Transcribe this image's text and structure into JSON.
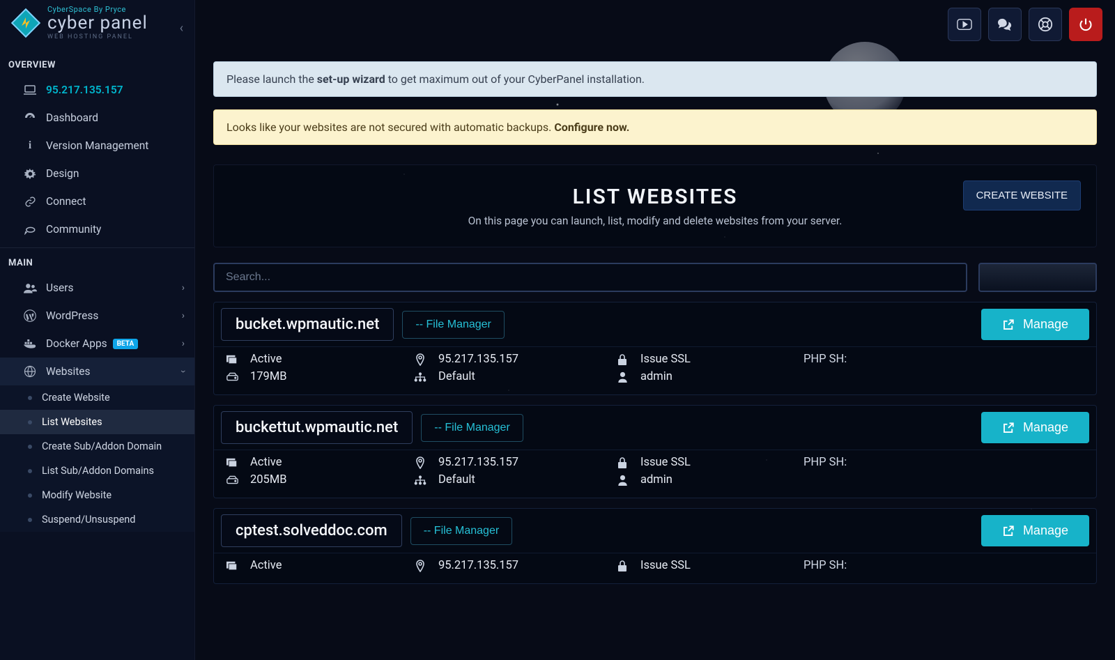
{
  "logo": {
    "tagline": "CyberSpace By Pryce",
    "main": "cyber panel",
    "sub": "WEB HOSTING PANEL"
  },
  "sidebar": {
    "sections": {
      "overview_label": "OVERVIEW",
      "main_label": "MAIN"
    },
    "ip": "95.217.135.157",
    "overview": [
      {
        "label": "Dashboard"
      },
      {
        "label": "Version Management"
      },
      {
        "label": "Design"
      },
      {
        "label": "Connect"
      },
      {
        "label": "Community"
      }
    ],
    "main": {
      "users": "Users",
      "wordpress": "WordPress",
      "docker": "Docker Apps",
      "docker_badge": "BETA",
      "websites": "Websites"
    },
    "websites_sub": [
      "Create Website",
      "List Websites",
      "Create Sub/Addon Domain",
      "List Sub/Addon Domains",
      "Modify Website",
      "Suspend/Unsuspend"
    ]
  },
  "alerts": {
    "info_pre": "Please launch the ",
    "info_bold": "set-up wizard",
    "info_post": " to get maximum out of your CyberPanel installation.",
    "warn_pre": "Looks like your websites are not secured with automatic backups. ",
    "warn_bold": "Configure now."
  },
  "hero": {
    "title": "LIST WEBSITES",
    "subtitle": "On this page you can launch, list, modify and delete websites from your server.",
    "create": "CREATE WEBSITE"
  },
  "toolbar": {
    "search_placeholder": "Search...",
    "pager_selected": ""
  },
  "common": {
    "file_manager": "-- File Manager",
    "manage": "Manage",
    "issue_ssl": "Issue SSL",
    "php_sh": "PHP SH:",
    "default": "Default"
  },
  "sites": [
    {
      "domain": "bucket.wpmautic.net",
      "status": "Active",
      "ip": "95.217.135.157",
      "size": "179MB",
      "plan": "Default",
      "owner": "admin"
    },
    {
      "domain": "buckettut.wpmautic.net",
      "status": "Active",
      "ip": "95.217.135.157",
      "size": "205MB",
      "plan": "Default",
      "owner": "admin"
    },
    {
      "domain": "cptest.solveddoc.com",
      "status": "Active",
      "ip": "95.217.135.157",
      "size": "",
      "plan": "",
      "owner": ""
    }
  ]
}
